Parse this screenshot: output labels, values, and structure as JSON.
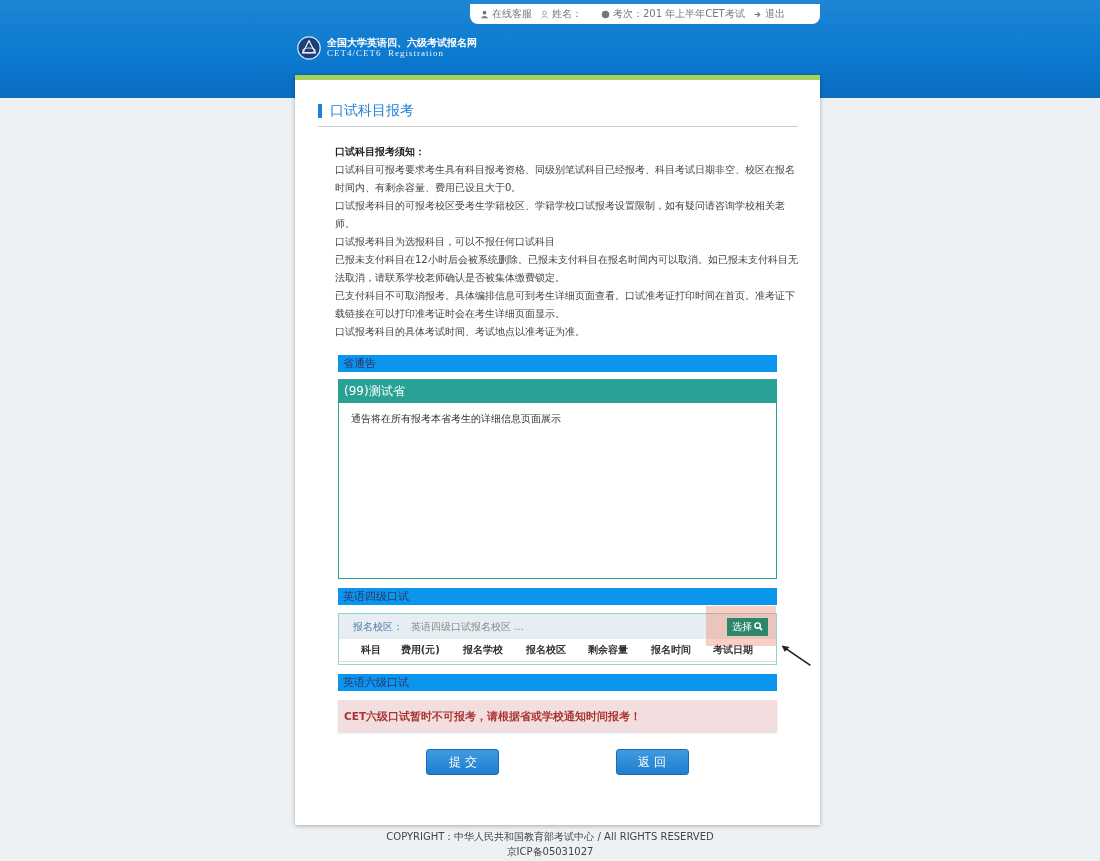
{
  "top_bar": {
    "service": "在线客服",
    "name_label": "姓名：",
    "exam": "考次：201  年上半年CET考试",
    "logout": "退出"
  },
  "logo": {
    "title": "全国大学英语四、六级考试报名网",
    "subtitle": "CET4/CET6  Registration"
  },
  "page_title": "口试科目报考",
  "notice": {
    "heading": "口试科目报考须知：",
    "lines": [
      "口试科目可报考要求考生具有科目报考资格、同级别笔试科目已经报考、科目考试日期非空、校区在报名时间内、有剩余容量、费用已设且大于0。",
      "口试报考科目的可报考校区受考生学籍校区、学籍学校口试报考设置限制，如有疑问请咨询学校相关老师。",
      "口试报考科目为选报科目，可以不报任何口试科目",
      "已报未支付科目在12小时后会被系统删除。已报未支付科目在报名时间内可以取消。如已报未支付科目无法取消，请联系学校老师确认是否被集体缴费锁定。",
      "已支付科目不可取消报考。具体编排信息可到考生详细页面查看。口试准考证打印时间在首页。准考证下载链接在可以打印准考证时会在考生详细页面显示。",
      "口试报考科目的具体考试时间、考试地点以准考证为准。"
    ]
  },
  "province_notice": {
    "header": "省通告",
    "province": "(99)测试省",
    "text": "通告将在所有报考本省考生的详细信息页面展示"
  },
  "cet4": {
    "header": "英语四级口试",
    "campus_label": "报名校区：",
    "campus_placeholder": "英语四级口试报名校区 ...",
    "select_button": "选择",
    "columns": [
      "科目",
      "费用(元)",
      "报名学校",
      "报名校区",
      "剩余容量",
      "报名时间",
      "考试日期"
    ]
  },
  "cet6": {
    "header": "英语六级口试",
    "alert": "CET六级口试暂时不可报考，请根据省或学校通知时间报考！"
  },
  "buttons": [
    "提 交",
    "返 回"
  ],
  "annotation": {
    "kind": "highlight-arrow"
  },
  "footer": {
    "copyright": "COPYRIGHT：中华人民共和国教育部考试中心 / All RIGHTS RESERVED",
    "icp": "京ICP备05031027"
  }
}
